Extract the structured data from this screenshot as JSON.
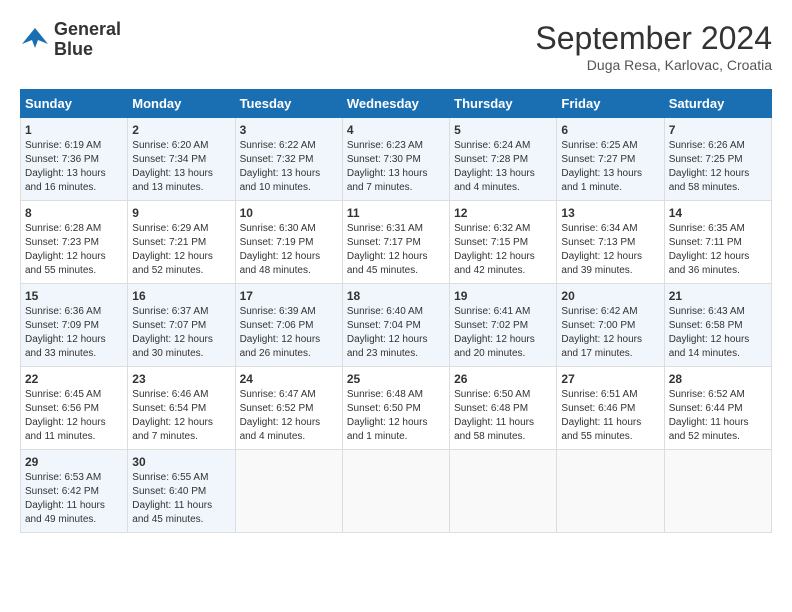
{
  "header": {
    "logo_line1": "General",
    "logo_line2": "Blue",
    "month": "September 2024",
    "location": "Duga Resa, Karlovac, Croatia"
  },
  "days_of_week": [
    "Sunday",
    "Monday",
    "Tuesday",
    "Wednesday",
    "Thursday",
    "Friday",
    "Saturday"
  ],
  "weeks": [
    [
      {
        "day": "1",
        "info": "Sunrise: 6:19 AM\nSunset: 7:36 PM\nDaylight: 13 hours\nand 16 minutes."
      },
      {
        "day": "2",
        "info": "Sunrise: 6:20 AM\nSunset: 7:34 PM\nDaylight: 13 hours\nand 13 minutes."
      },
      {
        "day": "3",
        "info": "Sunrise: 6:22 AM\nSunset: 7:32 PM\nDaylight: 13 hours\nand 10 minutes."
      },
      {
        "day": "4",
        "info": "Sunrise: 6:23 AM\nSunset: 7:30 PM\nDaylight: 13 hours\nand 7 minutes."
      },
      {
        "day": "5",
        "info": "Sunrise: 6:24 AM\nSunset: 7:28 PM\nDaylight: 13 hours\nand 4 minutes."
      },
      {
        "day": "6",
        "info": "Sunrise: 6:25 AM\nSunset: 7:27 PM\nDaylight: 13 hours\nand 1 minute."
      },
      {
        "day": "7",
        "info": "Sunrise: 6:26 AM\nSunset: 7:25 PM\nDaylight: 12 hours\nand 58 minutes."
      }
    ],
    [
      {
        "day": "8",
        "info": "Sunrise: 6:28 AM\nSunset: 7:23 PM\nDaylight: 12 hours\nand 55 minutes."
      },
      {
        "day": "9",
        "info": "Sunrise: 6:29 AM\nSunset: 7:21 PM\nDaylight: 12 hours\nand 52 minutes."
      },
      {
        "day": "10",
        "info": "Sunrise: 6:30 AM\nSunset: 7:19 PM\nDaylight: 12 hours\nand 48 minutes."
      },
      {
        "day": "11",
        "info": "Sunrise: 6:31 AM\nSunset: 7:17 PM\nDaylight: 12 hours\nand 45 minutes."
      },
      {
        "day": "12",
        "info": "Sunrise: 6:32 AM\nSunset: 7:15 PM\nDaylight: 12 hours\nand 42 minutes."
      },
      {
        "day": "13",
        "info": "Sunrise: 6:34 AM\nSunset: 7:13 PM\nDaylight: 12 hours\nand 39 minutes."
      },
      {
        "day": "14",
        "info": "Sunrise: 6:35 AM\nSunset: 7:11 PM\nDaylight: 12 hours\nand 36 minutes."
      }
    ],
    [
      {
        "day": "15",
        "info": "Sunrise: 6:36 AM\nSunset: 7:09 PM\nDaylight: 12 hours\nand 33 minutes."
      },
      {
        "day": "16",
        "info": "Sunrise: 6:37 AM\nSunset: 7:07 PM\nDaylight: 12 hours\nand 30 minutes."
      },
      {
        "day": "17",
        "info": "Sunrise: 6:39 AM\nSunset: 7:06 PM\nDaylight: 12 hours\nand 26 minutes."
      },
      {
        "day": "18",
        "info": "Sunrise: 6:40 AM\nSunset: 7:04 PM\nDaylight: 12 hours\nand 23 minutes."
      },
      {
        "day": "19",
        "info": "Sunrise: 6:41 AM\nSunset: 7:02 PM\nDaylight: 12 hours\nand 20 minutes."
      },
      {
        "day": "20",
        "info": "Sunrise: 6:42 AM\nSunset: 7:00 PM\nDaylight: 12 hours\nand 17 minutes."
      },
      {
        "day": "21",
        "info": "Sunrise: 6:43 AM\nSunset: 6:58 PM\nDaylight: 12 hours\nand 14 minutes."
      }
    ],
    [
      {
        "day": "22",
        "info": "Sunrise: 6:45 AM\nSunset: 6:56 PM\nDaylight: 12 hours\nand 11 minutes."
      },
      {
        "day": "23",
        "info": "Sunrise: 6:46 AM\nSunset: 6:54 PM\nDaylight: 12 hours\nand 7 minutes."
      },
      {
        "day": "24",
        "info": "Sunrise: 6:47 AM\nSunset: 6:52 PM\nDaylight: 12 hours\nand 4 minutes."
      },
      {
        "day": "25",
        "info": "Sunrise: 6:48 AM\nSunset: 6:50 PM\nDaylight: 12 hours\nand 1 minute."
      },
      {
        "day": "26",
        "info": "Sunrise: 6:50 AM\nSunset: 6:48 PM\nDaylight: 11 hours\nand 58 minutes."
      },
      {
        "day": "27",
        "info": "Sunrise: 6:51 AM\nSunset: 6:46 PM\nDaylight: 11 hours\nand 55 minutes."
      },
      {
        "day": "28",
        "info": "Sunrise: 6:52 AM\nSunset: 6:44 PM\nDaylight: 11 hours\nand 52 minutes."
      }
    ],
    [
      {
        "day": "29",
        "info": "Sunrise: 6:53 AM\nSunset: 6:42 PM\nDaylight: 11 hours\nand 49 minutes."
      },
      {
        "day": "30",
        "info": "Sunrise: 6:55 AM\nSunset: 6:40 PM\nDaylight: 11 hours\nand 45 minutes."
      },
      {
        "day": "",
        "info": ""
      },
      {
        "day": "",
        "info": ""
      },
      {
        "day": "",
        "info": ""
      },
      {
        "day": "",
        "info": ""
      },
      {
        "day": "",
        "info": ""
      }
    ]
  ]
}
